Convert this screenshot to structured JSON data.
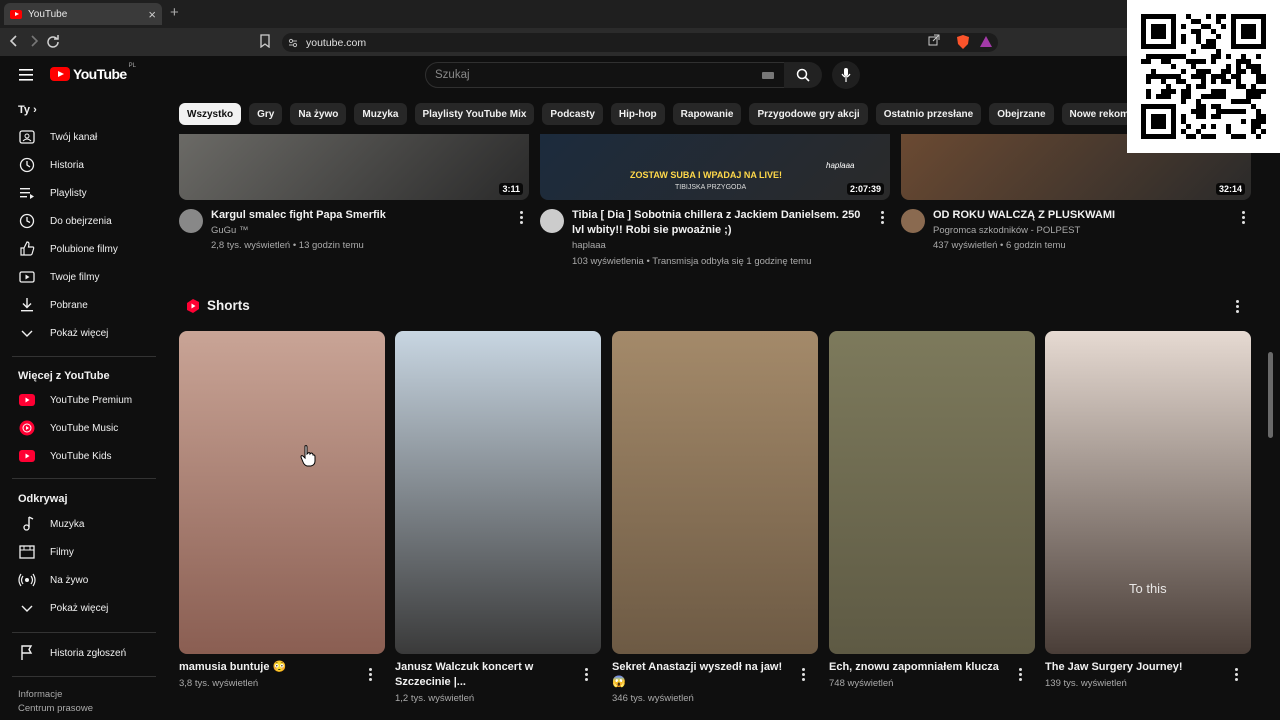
{
  "browser": {
    "tab_title": "YouTube",
    "new_tab_symbol": "+",
    "close_symbol": "×",
    "url": "youtube.com"
  },
  "header": {
    "logo_text": "YouTube",
    "logo_country": "PL",
    "search_placeholder": "Szukaj"
  },
  "chips": [
    "Wszystko",
    "Gry",
    "Na żywo",
    "Muzyka",
    "Playlisty YouTube Mix",
    "Podcasty",
    "Hip-hop",
    "Rapowanie",
    "Przygodowe gry akcji",
    "Ostatnio przesłane",
    "Obejrzane",
    "Nowe rekomendacje"
  ],
  "sidebar": {
    "you_title": "Ty",
    "you_items": [
      {
        "label": "Twój kanał",
        "icon": "channel-icon"
      },
      {
        "label": "Historia",
        "icon": "history-icon"
      },
      {
        "label": "Playlisty",
        "icon": "playlists-icon"
      },
      {
        "label": "Do obejrzenia",
        "icon": "watch-later-icon"
      },
      {
        "label": "Polubione filmy",
        "icon": "like-icon"
      },
      {
        "label": "Twoje filmy",
        "icon": "your-videos-icon"
      },
      {
        "label": "Pobrane",
        "icon": "download-icon"
      },
      {
        "label": "Pokaż więcej",
        "icon": "chevron-down-icon"
      }
    ],
    "more_title": "Więcej z YouTube",
    "more_items": [
      {
        "label": "YouTube Premium",
        "icon": "youtube-premium-icon"
      },
      {
        "label": "YouTube Music",
        "icon": "youtube-music-icon"
      },
      {
        "label": "YouTube Kids",
        "icon": "youtube-kids-icon"
      }
    ],
    "explore_title": "Odkrywaj",
    "explore_items": [
      {
        "label": "Muzyka",
        "icon": "music-icon"
      },
      {
        "label": "Filmy",
        "icon": "movies-icon"
      },
      {
        "label": "Na żywo",
        "icon": "live-icon"
      },
      {
        "label": "Pokaż więcej",
        "icon": "chevron-down-icon"
      }
    ],
    "report_history": "Historia zgłoszeń",
    "footer": [
      "Informacje",
      "Centrum prasowe"
    ]
  },
  "videos": [
    {
      "title": "Kargul smalec fight Papa Smerfik",
      "channel": "GuGu ™",
      "stats": "2,8 tys. wyświetleń • 13 godzin temu",
      "duration": "3:11",
      "thumb_color": "#6b6a66",
      "avatar_color": "#888888"
    },
    {
      "title": "Tibia [ Dia ] Sobotnia chillera z Jackiem Danielsem. 250 lvl wbity!! Robi sie pwoażnie ;)",
      "channel": "haplaaa",
      "stats": "103 wyświetlenia • Transmisja odbyła się 1 godzinę temu",
      "duration": "2:07:39",
      "thumb_color": "#1c2b3d",
      "avatar_color": "#cccccc",
      "overlay_text": "ZOSTAW SUBA I WPADAJ NA LIVE!",
      "overlay_sub": "TIBIJSKA PRZYGODA",
      "social_handle": "haplaaa"
    },
    {
      "title": "OD ROKU WALCZĄ Z PLUSKWAMI",
      "channel": "Pogromca szkodników - POLPEST",
      "stats": "437 wyświetleń • 6 godzin temu",
      "duration": "32:14",
      "thumb_color": "#6b4a32",
      "avatar_color": "#8a6a50"
    }
  ],
  "shorts": {
    "title": "Shorts",
    "items": [
      {
        "title": "mamusia buntuje 😳",
        "views": "3,8 tys. wyświetleń",
        "colors": [
          "#c9a496",
          "#8a5e52"
        ]
      },
      {
        "title": "Janusz Walczuk koncert w Szczecinie |...",
        "views": "1,2 tys. wyświetleń",
        "colors": [
          "#c8d6e2",
          "#3a3a3a"
        ]
      },
      {
        "title": "Sekret Anastazji wyszedł na jaw! 😱",
        "views": "346 tys. wyświetleń",
        "colors": [
          "#a48a6a",
          "#6d5a44"
        ]
      },
      {
        "title": "Ech, znowu zapomniałem klucza",
        "views": "748 wyświetleń",
        "colors": [
          "#7d7a5c",
          "#5e5a44"
        ]
      },
      {
        "title": "The Jaw Surgery Journey!",
        "views": "139 tys. wyświetleń",
        "colors": [
          "#e6dad2",
          "#4a3e38"
        ],
        "overlay_text": "To this"
      }
    ]
  }
}
